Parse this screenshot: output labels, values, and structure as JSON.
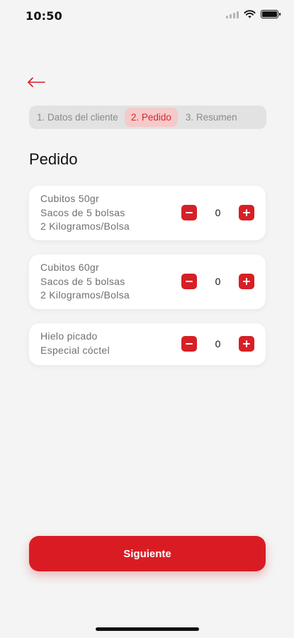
{
  "status_bar": {
    "time": "10:50"
  },
  "navigation": {
    "back_icon": "arrow-left-icon"
  },
  "stepper": {
    "steps": [
      {
        "label": "1. Datos del cliente",
        "active": false
      },
      {
        "label": "2. Pedido",
        "active": true
      },
      {
        "label": "3. Resumen",
        "active": false
      }
    ]
  },
  "page": {
    "title": "Pedido"
  },
  "products": [
    {
      "lines": [
        "Cubitos 50gr",
        "Sacos de 5 bolsas",
        "2 Kilogramos/Bolsa"
      ],
      "quantity": "0"
    },
    {
      "lines": [
        "Cubitos 60gr",
        "Sacos de 5 bolsas",
        "2 Kilogramos/Bolsa"
      ],
      "quantity": "0"
    },
    {
      "lines": [
        "Hielo picado",
        "Especial cóctel"
      ],
      "quantity": "0"
    }
  ],
  "actions": {
    "next_label": "Siguiente"
  },
  "colors": {
    "accent": "#d91c24",
    "step_active_bg": "#f5caca",
    "background": "#f4f4f4"
  }
}
